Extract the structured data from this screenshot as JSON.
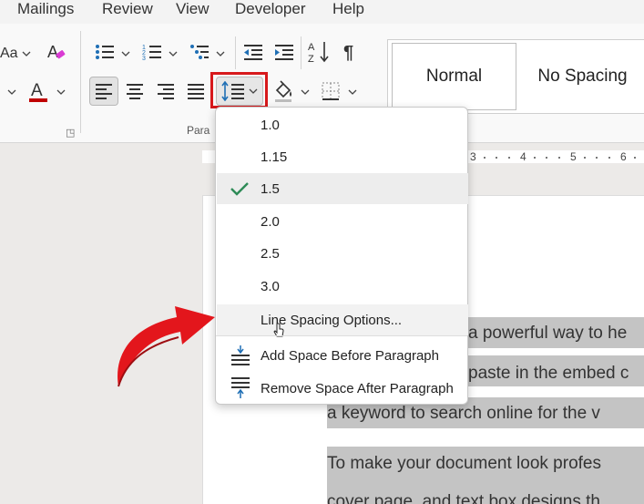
{
  "menu_tabs": [
    "Mailings",
    "Review",
    "View",
    "Developer",
    "Help"
  ],
  "ribbon": {
    "font_case_label": "Aa",
    "paragraph_group_label": "Para",
    "styles": {
      "normal": "Normal",
      "no_spacing": "No Spacing"
    }
  },
  "ruler": {
    "numbers": [
      "3",
      "4",
      "5",
      "6"
    ]
  },
  "line_spacing_menu": {
    "options": [
      "1.0",
      "1.15",
      "1.5",
      "2.0",
      "2.5",
      "3.0"
    ],
    "selected": "1.5",
    "line_spacing_options": "Line Spacing Options...",
    "add_space_before": "Add Space Before Paragraph",
    "remove_space_after": "Remove Space After Paragraph"
  },
  "document": {
    "lines": [
      "a powerful way to he",
      "paste in the embed c",
      "a keyword to search online for the v",
      "To make your document look profes",
      "cover page, and text box designs th"
    ]
  },
  "colors": {
    "highlight_border": "#d7191c",
    "arrow": "#e3161c",
    "check": "#2e8b57",
    "font_color": "#c00000",
    "selection": "#c4c4c4"
  }
}
